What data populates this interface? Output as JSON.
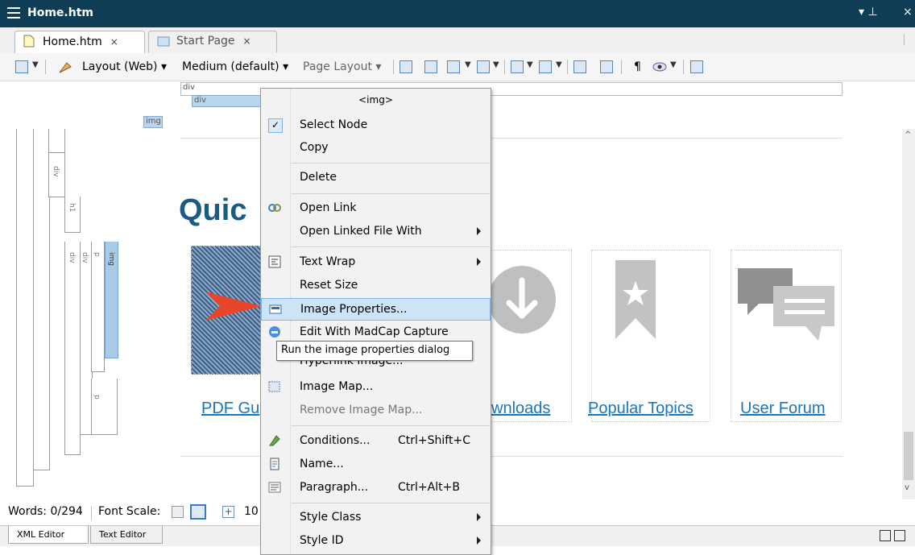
{
  "titlebar": {
    "title": "Home.htm",
    "pin_glyph": "▾  ⊥",
    "close_glyph": "×"
  },
  "tabs": [
    {
      "label": "Home.htm",
      "close": "×",
      "active": true,
      "icon": "document-icon"
    },
    {
      "label": "Start Page",
      "close": "×",
      "active": false,
      "icon": "start-page-icon"
    }
  ],
  "toolbar": {
    "layout": "Layout (Web)",
    "medium": "Medium (default)",
    "page_layout": "Page Layout",
    "pilcrow": "¶"
  },
  "structure": {
    "div_outer": "div",
    "div_inner": "div",
    "img_tag": "img",
    "left_labels": [
      "div",
      "h1",
      "div",
      "div",
      "p",
      "img",
      "p"
    ]
  },
  "content": {
    "heading": "Quic",
    "cards": [
      {
        "label": "PDF Gu"
      },
      {
        "label": "wnloads"
      },
      {
        "label": "Popular Topics"
      },
      {
        "label": "User Forum"
      }
    ]
  },
  "context_menu": {
    "header": "<img>",
    "items": [
      {
        "label": "Select Node",
        "icon": "check-icon"
      },
      {
        "label": "Copy"
      },
      {
        "label": "Delete"
      },
      {
        "label": "Open Link",
        "icon": "link-icon"
      },
      {
        "label": "Open Linked File With",
        "submenu": true
      },
      {
        "label": "Text Wrap",
        "icon": "text-wrap-icon",
        "submenu": true
      },
      {
        "label": "Reset Size"
      },
      {
        "label": "Image Properties...",
        "icon": "image-properties-icon",
        "highlighted": true
      },
      {
        "label": "Edit With MadCap Capture",
        "icon": "capture-icon"
      },
      {
        "label": "Hyperlink Image..."
      },
      {
        "label": "Image Map...",
        "icon": "image-map-icon"
      },
      {
        "label": "Remove Image Map...",
        "disabled": true
      },
      {
        "label": "Conditions...",
        "shortcut": "Ctrl+Shift+C",
        "icon": "conditions-icon"
      },
      {
        "label": "Name...",
        "icon": "name-icon"
      },
      {
        "label": "Paragraph...",
        "shortcut": "Ctrl+Alt+B",
        "icon": "paragraph-icon"
      },
      {
        "label": "Style Class",
        "submenu": true
      },
      {
        "label": "Style ID",
        "submenu": true
      }
    ]
  },
  "tooltip": "Run the image properties dialog",
  "statusbar": {
    "words": "Words: 0/294",
    "font_scale_label": "Font Scale:",
    "zoom": "10"
  },
  "bottom_tabs": [
    "XML Editor",
    "Text Editor"
  ],
  "colors": {
    "titlebar": "#0e3d55",
    "link": "#1b75bb",
    "heading": "#1a5b86",
    "highlight": "#cde4f7"
  }
}
